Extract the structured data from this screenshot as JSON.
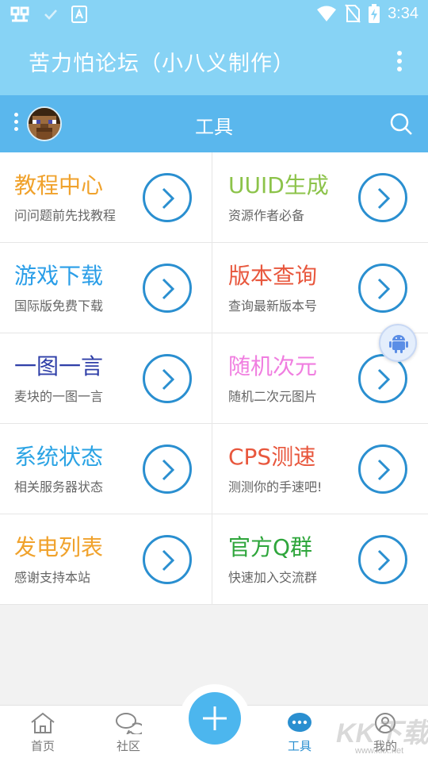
{
  "status_bar": {
    "time": "3:34",
    "icons": [
      "bug-app-icon",
      "check-icon",
      "a-notification-icon",
      "wifi-icon",
      "no-sim-icon",
      "battery-charging-icon"
    ]
  },
  "app_bar": {
    "title": "苦力怕论坛（小八义制作）",
    "menu_icon": "more-vertical-icon"
  },
  "toolbar": {
    "title": "工具",
    "menu_icon": "more-vertical-icon",
    "search_icon": "search-icon"
  },
  "tools": [
    {
      "title": "教程中心",
      "subtitle": "问问题前先找教程",
      "color": "#f0a22c"
    },
    {
      "title": "UUID生成",
      "subtitle": "资源作者必备",
      "color": "#8cc34a"
    },
    {
      "title": "游戏下载",
      "subtitle": "国际版免费下载",
      "color": "#2a9ee8"
    },
    {
      "title": "版本查询",
      "subtitle": "查询最新版本号",
      "color": "#e8573d"
    },
    {
      "title": "一图一言",
      "subtitle": "麦块的一图一言",
      "color": "#2f3fa8"
    },
    {
      "title": "随机次元",
      "subtitle": "随机二次元图片",
      "color": "#f07ee0"
    },
    {
      "title": "系统状态",
      "subtitle": "相关服务器状态",
      "color": "#2aa3e4"
    },
    {
      "title": "CPS测速",
      "subtitle": "测测你的手速吧!",
      "color": "#e8573d"
    },
    {
      "title": "发电列表",
      "subtitle": "感谢支持本站",
      "color": "#f0a22c"
    },
    {
      "title": "官方Q群",
      "subtitle": "快速加入交流群",
      "color": "#2fa63c"
    }
  ],
  "colors": {
    "header": "#87d3f5",
    "toolbar": "#5ab7ed",
    "accent": "#2a8fd0",
    "fab": "#4cb6ee"
  },
  "bottom_nav": {
    "items": [
      {
        "label": "首页",
        "icon": "home-icon"
      },
      {
        "label": "社区",
        "icon": "chat-bubbles-icon"
      },
      {
        "label": "工具",
        "icon": "chat-dots-icon",
        "active": true
      },
      {
        "label": "我的",
        "icon": "person-icon"
      }
    ],
    "fab_icon": "plus-icon"
  },
  "watermark": {
    "text": "KK下载",
    "url": "www.kkx.net"
  }
}
